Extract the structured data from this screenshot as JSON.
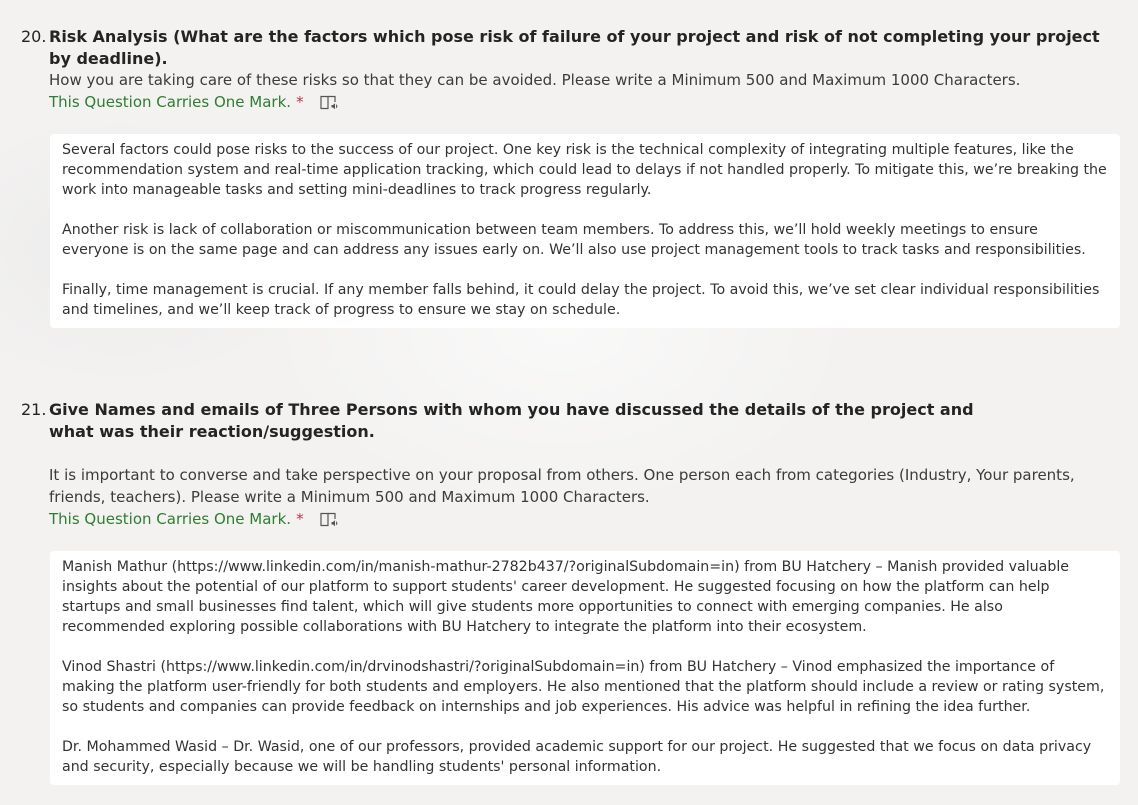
{
  "questions": [
    {
      "number": "20.",
      "title": "Risk Analysis (What are the factors which pose risk of failure of your project and risk of not completing your project by deadline).",
      "description": "How you are taking care of these risks so that they can be avoided. Please write a Minimum 500 and Maximum 1000 Characters.",
      "mark_text": "This Question Carries One Mark.",
      "required_marker": "*",
      "answer_paragraphs": [
        "Several factors could pose risks to the success of our project. One key risk is the technical complexity of integrating multiple features, like the recommendation system and real-time application tracking, which could lead to delays if not handled properly. To mitigate this, we’re breaking the work into manageable tasks and setting mini-deadlines to track progress regularly.",
        "Another risk is lack of collaboration or miscommunication between team members. To address this, we’ll hold weekly meetings to ensure everyone is on the same page and can address any issues early on. We’ll also use project management tools to track tasks and responsibilities.",
        "Finally, time management is crucial. If any member falls behind, it could delay the project. To avoid this, we’ve set clear individual responsibilities and timelines, and we’ll keep track of progress to ensure we stay on schedule."
      ]
    },
    {
      "number": "21.",
      "title": "Give Names and emails of Three Persons with whom you have discussed the details of the project and what was their reaction/suggestion.",
      "description": "It is important to converse and take perspective on your proposal from others. One person each from categories (Industry, Your parents, friends, teachers). Please write a Minimum 500 and Maximum 1000 Characters.",
      "mark_text": "This Question Carries One Mark.",
      "required_marker": "*",
      "answer_paragraphs": [
        "Manish Mathur (https://www.linkedin.com/in/manish-mathur-2782b437/?originalSubdomain=in) from BU Hatchery – Manish provided valuable insights about the potential of our platform to support students' career development. He suggested focusing on how the platform can help startups and small businesses find talent, which will give students more opportunities to connect with emerging companies. He also recommended exploring possible collaborations with BU Hatchery to integrate the platform into their ecosystem.",
        "Vinod Shastri (https://www.linkedin.com/in/drvinodshastri/?originalSubdomain=in) from BU Hatchery – Vinod emphasized the importance of making the platform user-friendly for both students and employers. He also mentioned that the platform should include a review or rating system, so students and companies can provide feedback on internships and job experiences. His advice was helpful in refining the idea further.",
        "Dr. Mohammed Wasid – Dr. Wasid, one of our professors, provided academic support for our project. He suggested that we focus on data privacy and security, especially because we will be handling students' personal information."
      ]
    }
  ],
  "icons": {
    "immersive_reader": "immersive-reader-icon"
  },
  "colors": {
    "mark_text": "#2e7d32",
    "required": "#c4314b",
    "answer_bg": "#ffffff",
    "page_bg": "#f3f2f1"
  }
}
